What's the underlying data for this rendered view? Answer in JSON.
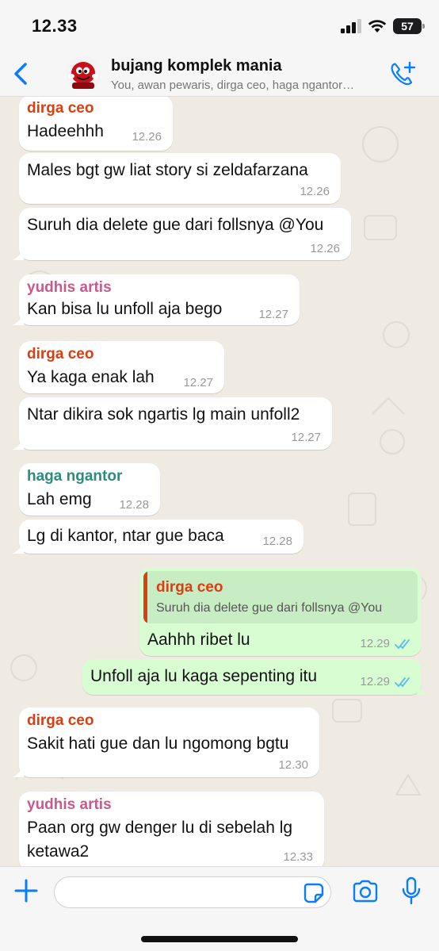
{
  "status_bar": {
    "time": "12.33",
    "battery": "57"
  },
  "header": {
    "group_name": "bujang komplek mania",
    "members": "You, awan pewaris, dirga ceo, haga ngantor…"
  },
  "colors": {
    "accent": "#0a7cff",
    "sender_dirga": "#d83f12",
    "sender_yudhis": "#c75a8c",
    "sender_haga": "#2f8a7e",
    "outgoing_bubble": "#d9fdd3",
    "incoming_bubble": "#ffffff",
    "read_ticks": "#53bdeb"
  },
  "messages": [
    {
      "id": 0,
      "direction": "in",
      "sender": "dirga ceo",
      "text": "Hadeehhh",
      "time": "12.26"
    },
    {
      "id": 1,
      "direction": "in",
      "text": "Males bgt gw liat story si zeldafarzana",
      "time": "12.26"
    },
    {
      "id": 2,
      "direction": "in",
      "text": "Suruh dia delete gue dari follsnya @You",
      "time": "12.26"
    },
    {
      "id": 3,
      "direction": "in",
      "sender": "yudhis artis",
      "text": "Kan bisa lu unfoll aja bego",
      "time": "12.27"
    },
    {
      "id": 4,
      "direction": "in",
      "sender": "dirga ceo",
      "text": "Ya kaga enak lah",
      "time": "12.27"
    },
    {
      "id": 5,
      "direction": "in",
      "text": "Ntar dikira sok ngartis lg main unfoll2",
      "time": "12.27"
    },
    {
      "id": 6,
      "direction": "in",
      "sender": "haga ngantor",
      "text": "Lah emg",
      "time": "12.28"
    },
    {
      "id": 7,
      "direction": "in",
      "text": "Lg di kantor, ntar gue baca",
      "time": "12.28"
    },
    {
      "id": 8,
      "direction": "out",
      "quote_sender": "dirga ceo",
      "quote_text": "Suruh dia delete gue dari follsnya @You",
      "text": "Aahhh ribet lu",
      "time": "12.29",
      "status": "read"
    },
    {
      "id": 9,
      "direction": "out",
      "text": "Unfoll aja lu kaga sepenting itu",
      "time": "12.29",
      "status": "read"
    },
    {
      "id": 10,
      "direction": "in",
      "sender": "dirga ceo",
      "text": "Sakit hati gue dan lu ngomong bgtu",
      "time": "12.30"
    },
    {
      "id": 11,
      "direction": "in",
      "sender": "yudhis artis",
      "text": "Paan org gw denger lu di sebelah lg",
      "text2": "ketawa2",
      "time": "12.33"
    }
  ],
  "input": {
    "value": "",
    "placeholder": ""
  },
  "icons": {
    "back": "chevron-left-icon",
    "call": "add-call-icon",
    "plus": "plus-icon",
    "sticker": "sticker-icon",
    "camera": "camera-icon",
    "mic": "microphone-icon"
  }
}
